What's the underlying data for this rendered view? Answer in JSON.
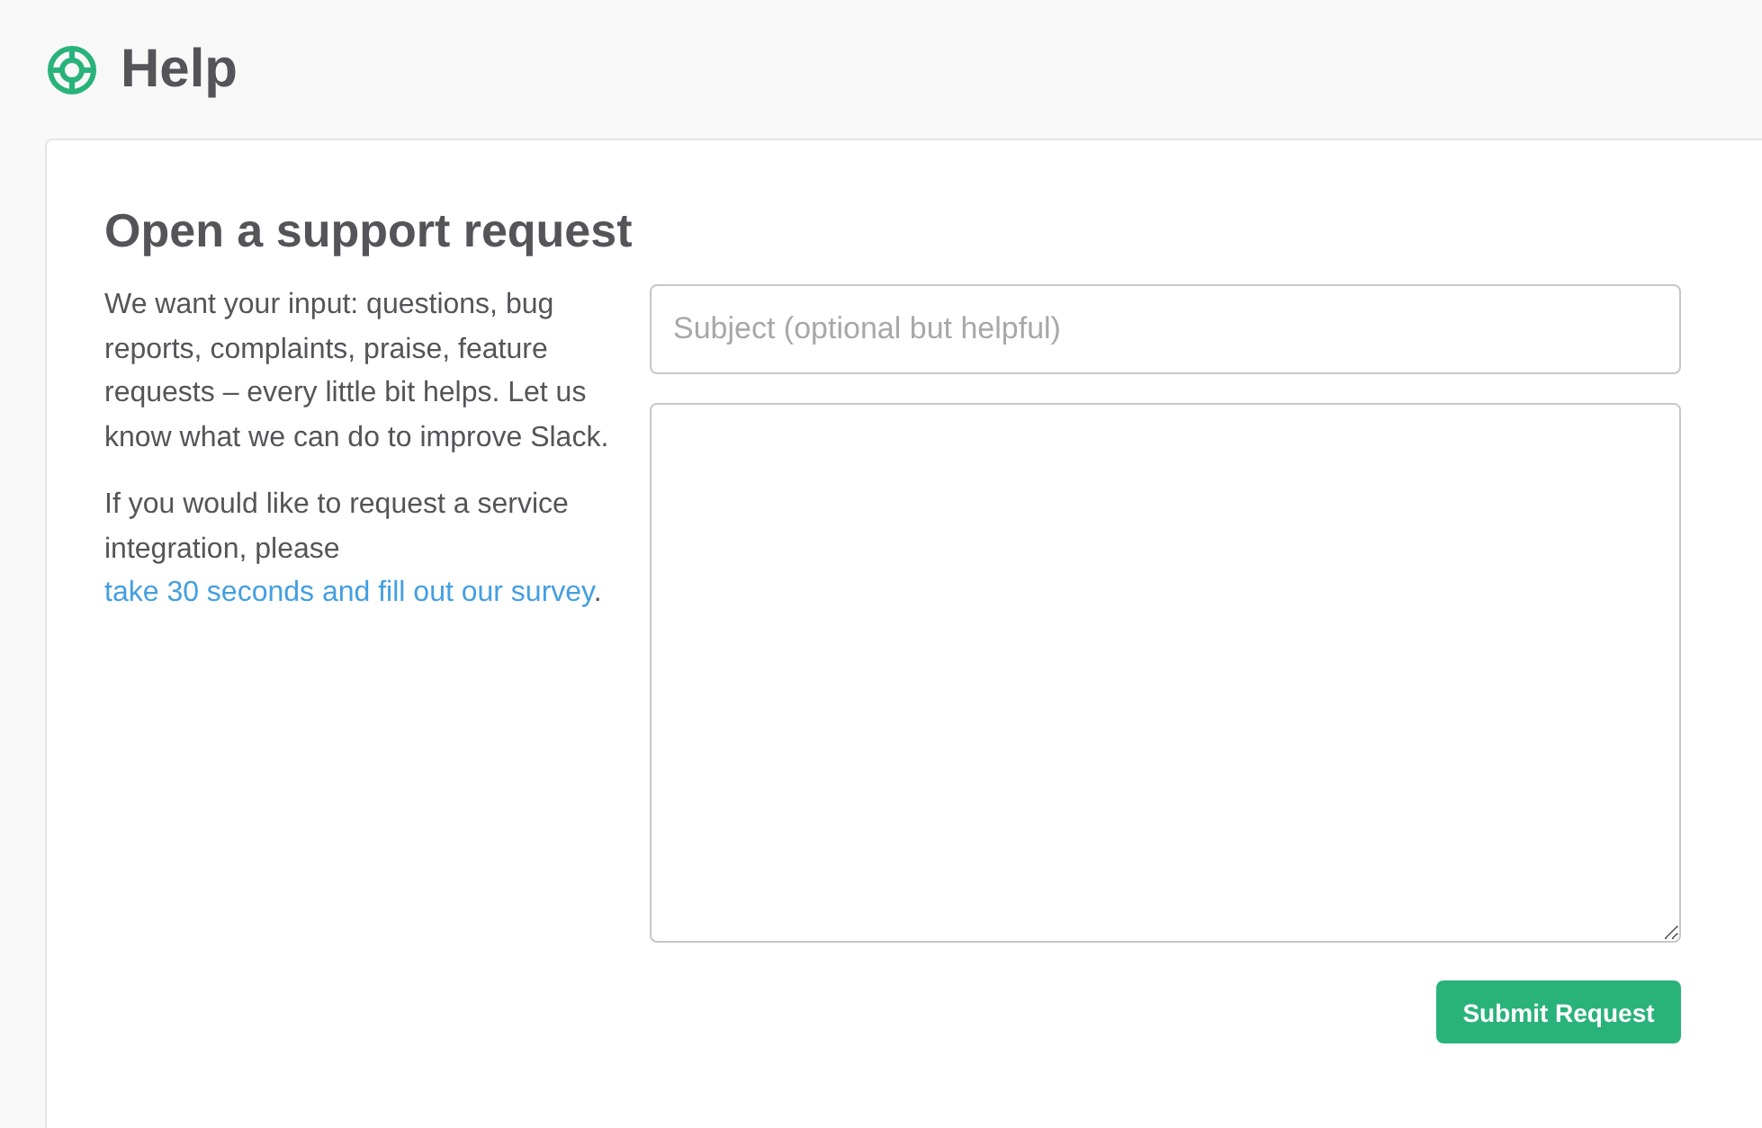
{
  "header": {
    "title": "Help"
  },
  "card": {
    "heading": "Open a support request",
    "intro": "We want your input: questions, bug reports, complaints, praise, feature requests – every little bit helps. Let us know what we can do to improve Slack.",
    "integration_note": {
      "text_before": "If you would like to request a service integration, please ",
      "link": "take 30 seconds and fill out our survey",
      "text_after": "."
    }
  },
  "form": {
    "fields": [
      {
        "kind": "text",
        "placeholder": "Subject (optional but helpful)"
      },
      {
        "kind": "multiline"
      }
    ],
    "submit_button": "Submit Request"
  }
}
